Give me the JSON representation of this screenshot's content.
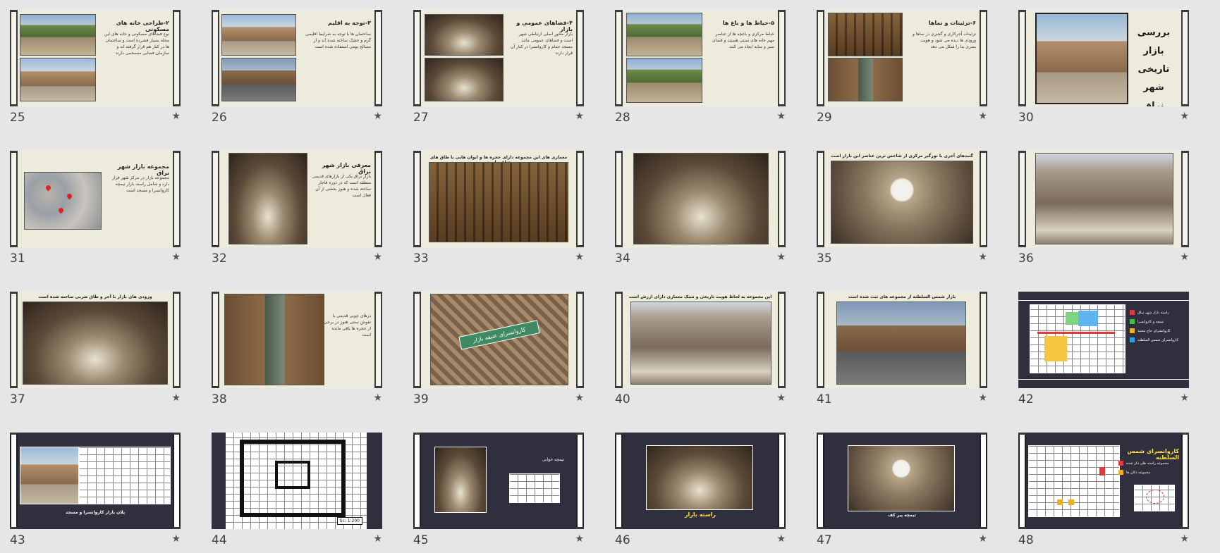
{
  "slides": [
    {
      "n": "25",
      "title": "۲-طراحی خانه های مسکونی",
      "body": "نوع فضاهای مسکونی و خانه های این محله بسیار فشرده است و ساختمان ها در کنار هم قرار گرفته اند و سازمان فضایی منسجمی دارند"
    },
    {
      "n": "26",
      "title": "۳-توجه به اقلیم",
      "body": "ساختمان ها با توجه به شرایط اقلیمی گرم و خشک ساخته شده اند و از مصالح بومی استفاده شده است"
    },
    {
      "n": "27",
      "title": "۴-فضاهای عمومی و بازار",
      "body": "بازار محور اصلی ارتباطی شهر است و فضاهای عمومی مانند مسجد حمام و کاروانسرا در کنار آن قرار دارند"
    },
    {
      "n": "28",
      "title": "۵-حیاط ها و باغ ها",
      "body": "حیاط مرکزی و باغچه ها از عناصر مهم خانه های سنتی هستند و فضای سبز و سایه ایجاد می کنند"
    },
    {
      "n": "29",
      "title": "۶-تزئینات و نماها",
      "body": "تزئینات آجرکاری و گچبری در نماها و ورودی ها دیده می شود و هویت بصری بنا را شکل می دهد"
    },
    {
      "n": "30",
      "title_lines": [
        "بررسی",
        "بازار تاریخی",
        "شهر نراق"
      ]
    },
    {
      "n": "31",
      "title": "مجموعه بازار شهر نراق",
      "body": "مجموعه بازار در مرکز شهر قرار دارد و شامل راسته بازار تیمچه کاروانسرا و مسجد است"
    },
    {
      "n": "32",
      "title": "معرفی بازار شهر نراق",
      "body": "بازار نراق یکی از بازارهای قدیمی منطقه است که در دوره قاجار ساخته شده و هنوز بخشی از آن فعال است"
    },
    {
      "n": "33",
      "caption": "معماری های این مجموعه دارای حجره ها و ایوان هایی با طاق های جناغی است"
    },
    {
      "n": "34"
    },
    {
      "n": "35",
      "caption": "گنبدهای آجری با نورگیر مرکزی از شاخص ترین عناصر این بازار است"
    },
    {
      "n": "36"
    },
    {
      "n": "37",
      "caption": "ورودی های بازار با آجر و طاق ضربی ساخته شده است"
    },
    {
      "n": "38",
      "body": "درهای چوبی قدیمی با نقوش سنتی هنوز در برخی از حجره ها باقی مانده است"
    },
    {
      "n": "39",
      "sign": "کاروانسرای عتیقه بازار"
    },
    {
      "n": "40",
      "caption": "این مجموعه به لحاظ هویت تاریخی و سبک معماری دارای ارزش است"
    },
    {
      "n": "41",
      "caption": "بازار شمس السلطنه از مجموعه های ثبت شده است"
    },
    {
      "n": "42",
      "legend": [
        "راسته بازار شهر نراق",
        "تیمچه و کاروانسرا",
        "کاروانسرای حاج محمد",
        "کاروانسرای شمس السلطنه"
      ]
    },
    {
      "n": "43",
      "caption": "پلان بازار کاروانسرا و مسجد"
    },
    {
      "n": "44",
      "scale": "Sc: 1:200"
    },
    {
      "n": "45",
      "label": "تیمچه خوابی"
    },
    {
      "n": "46",
      "caption": "راسته بازار"
    },
    {
      "n": "47",
      "caption": "تیمچه پیر کف"
    },
    {
      "n": "48",
      "title": "کاروانسرای شمس السلطنه",
      "legend": [
        "مجموعه راسته های ذکر شده",
        "مجموعه دکان ها"
      ]
    }
  ],
  "colors": {
    "legend": [
      "#e03a3a",
      "#3cc04a",
      "#f0b01a",
      "#2aa0e8"
    ]
  },
  "icons": {
    "star": "★"
  }
}
